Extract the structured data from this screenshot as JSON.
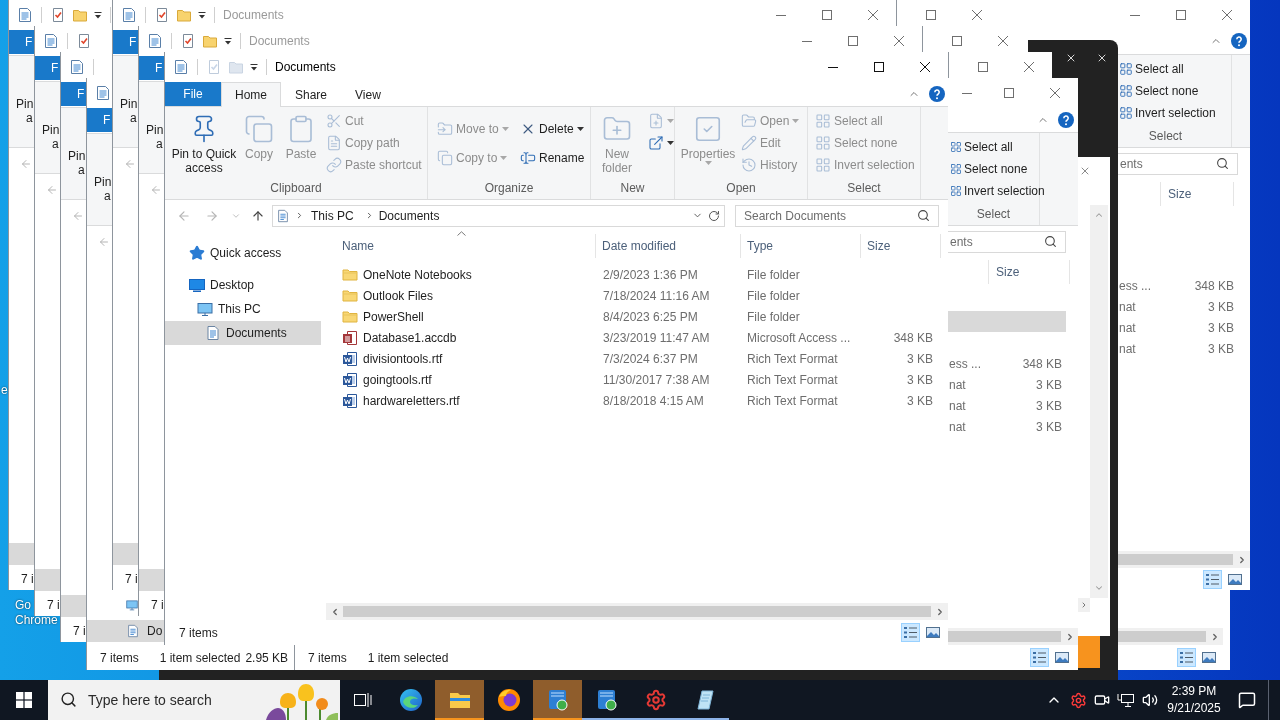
{
  "desktop": {
    "icon_labels": [
      {
        "lines": [
          "e"
        ]
      },
      {
        "lines": [
          "Go",
          "Chrome"
        ]
      }
    ]
  },
  "cascade_windows": [
    {
      "file_tab": "F",
      "pin_lines": [
        "Pin",
        "a"
      ],
      "nav_selected": true,
      "status": "7 i"
    },
    {
      "file_tab": "F",
      "pin_lines": [
        "Pin",
        "a"
      ],
      "nav_selected": true,
      "status": "7 i"
    },
    {
      "file_tab": "F",
      "pin_lines": [
        "Pin",
        "a"
      ],
      "nav_selected": true,
      "status": "7 i"
    },
    {
      "title": "Documents",
      "quick_access_disabled": false,
      "file_tab": "F",
      "pin_lines": [
        "Pin",
        "a"
      ],
      "nav_selected": true,
      "status": "7 i"
    },
    {
      "title": "Documents",
      "quick_access_disabled": false,
      "file_tab": "F",
      "pin_lines": [
        "Pin",
        "a"
      ],
      "nav_selected": true,
      "status": "7 i"
    }
  ],
  "lower_window": {
    "file_tab": "F",
    "pin_lines": [
      "Pin",
      "a"
    ],
    "nav_items": [
      {
        "selected": false
      },
      {
        "label": "Do",
        "selected": true
      }
    ],
    "status_bar": {
      "items": "7 items",
      "selection": "1 item selected",
      "size": "2.95 KB"
    }
  },
  "back_window": {
    "select_group": {
      "label": "Select",
      "items": [
        {
          "label": "Select all",
          "disabled": false
        },
        {
          "label": "Select none",
          "disabled": false
        },
        {
          "label": "Invert selection",
          "disabled": false
        }
      ]
    },
    "search": {
      "placeholder": "ents"
    },
    "columns": [
      {
        "label": "Size"
      }
    ],
    "rows": [
      {
        "selected": false
      },
      {
        "selected": false
      },
      {
        "selected": false
      },
      {
        "type": "ess ...",
        "size": "348 KB",
        "selected": false
      },
      {
        "type": "nat",
        "size": "3 KB",
        "selected": false
      },
      {
        "type": "nat",
        "size": "3 KB",
        "selected": false
      },
      {
        "type": "nat",
        "size": "3 KB",
        "selected": false
      }
    ],
    "view_buttons": [
      {
        "selected": true
      },
      {
        "selected": false
      }
    ]
  },
  "middle_window": {
    "select_group": {
      "label": "Select",
      "items": [
        {
          "label": "Select all",
          "disabled": false
        },
        {
          "label": "Select none",
          "disabled": false
        },
        {
          "label": "Invert selection",
          "disabled": false
        }
      ]
    },
    "search": {
      "placeholder": "ents"
    },
    "columns": [
      {
        "label": "Size"
      }
    ],
    "rows": [
      {
        "selected": false
      },
      {
        "selected": true
      },
      {
        "selected": false
      },
      {
        "type": "ess ...",
        "size": "348 KB",
        "selected": false
      },
      {
        "type": "nat",
        "size": "3 KB",
        "selected": false
      },
      {
        "type": "nat",
        "size": "3 KB",
        "selected": false
      },
      {
        "type": "nat",
        "size": "3 KB",
        "selected": false
      }
    ],
    "status_bar": {
      "items": "7 items",
      "selection": "1 item selected"
    },
    "view_buttons": [
      {
        "selected": true
      },
      {
        "selected": false
      }
    ]
  },
  "lower_right_window": {
    "view_buttons": [
      {
        "selected": true
      },
      {
        "selected": false
      }
    ]
  },
  "main_window": {
    "title": "Documents",
    "quick_access_disabled": true,
    "ribbon_tabs": [
      {
        "label": "File",
        "kind": "file",
        "selected": false
      },
      {
        "label": "Home",
        "kind": "tab",
        "selected": true
      },
      {
        "label": "Share",
        "kind": "tab",
        "selected": false
      },
      {
        "label": "View",
        "kind": "tab",
        "selected": false
      }
    ],
    "ribbon_groups": [
      {
        "label": "Clipboard",
        "columns": [
          {
            "kind": "large",
            "items": [
              {
                "label": "Pin to Quick access",
                "disabled": false,
                "dropdown": false
              }
            ]
          },
          {
            "kind": "large",
            "items": [
              {
                "label": "Copy",
                "disabled": true,
                "dropdown": false
              }
            ]
          },
          {
            "kind": "large",
            "items": [
              {
                "label": "Paste",
                "disabled": true,
                "dropdown": false
              }
            ]
          },
          {
            "kind": "stack",
            "items": [
              {
                "label": "Cut",
                "disabled": true,
                "dropdown": false
              },
              {
                "label": "Copy path",
                "disabled": true,
                "dropdown": false
              },
              {
                "label": "Paste shortcut",
                "disabled": true,
                "dropdown": false
              }
            ]
          }
        ]
      },
      {
        "label": "Organize",
        "columns": [
          {
            "kind": "pair",
            "items": [
              {
                "label": "Move to",
                "disabled": true,
                "dropdown": true
              },
              {
                "label": "Copy to",
                "disabled": true,
                "dropdown": true
              }
            ]
          },
          {
            "kind": "pair",
            "items": [
              {
                "label": "Delete",
                "disabled": false,
                "dropdown": true
              },
              {
                "label": "Rename",
                "disabled": false,
                "dropdown": false
              }
            ]
          }
        ]
      },
      {
        "label": "New",
        "columns": [
          {
            "kind": "large",
            "items": [
              {
                "label": "New folder",
                "disabled": true,
                "dropdown": false
              }
            ]
          },
          {
            "kind": "stack",
            "items": [
              {
                "disabled": true,
                "dropdown": true
              },
              {
                "disabled": false,
                "dropdown": true
              }
            ]
          }
        ]
      },
      {
        "label": "Open",
        "columns": [
          {
            "kind": "large",
            "items": [
              {
                "label": "Properties",
                "disabled": true,
                "dropdown": true
              }
            ]
          },
          {
            "kind": "stack",
            "items": [
              {
                "label": "Open",
                "disabled": true,
                "dropdown": true
              },
              {
                "label": "Edit",
                "disabled": true,
                "dropdown": false
              },
              {
                "label": "History",
                "disabled": true,
                "dropdown": false
              }
            ]
          }
        ]
      },
      {
        "label": "Select",
        "columns": [
          {
            "kind": "stack",
            "items": [
              {
                "label": "Select all",
                "disabled": true,
                "dropdown": false
              },
              {
                "label": "Select none",
                "disabled": true,
                "dropdown": false
              },
              {
                "label": "Invert selection",
                "disabled": true,
                "dropdown": false
              }
            ]
          }
        ]
      }
    ],
    "address": {
      "nav_buttons": [
        {
          "disabled": true
        },
        {
          "disabled": true
        },
        {
          "disabled": true
        },
        {
          "disabled": false
        }
      ],
      "path": [
        "This PC",
        "Documents"
      ],
      "search_placeholder": "Search Documents"
    },
    "nav_pane": [
      {
        "label": "Quick access",
        "selected": false
      },
      {
        "label": "Desktop",
        "selected": false,
        "children": [
          {
            "label": "This PC",
            "selected": false,
            "children": [
              {
                "label": "Documents",
                "selected": true
              }
            ]
          }
        ]
      }
    ],
    "columns": [
      {
        "label": "Name",
        "sorted": true
      },
      {
        "label": "Date modified",
        "sorted": false
      },
      {
        "label": "Type",
        "sorted": false
      },
      {
        "label": "Size",
        "sorted": false
      }
    ],
    "rows": [
      {
        "kind": "folder",
        "name": "OneNote Notebooks",
        "date": "2/9/2023 1:36 PM",
        "type": "File folder",
        "selected": false
      },
      {
        "kind": "folder",
        "name": "Outlook Files",
        "date": "7/18/2024 11:16 AM",
        "type": "File folder",
        "selected": false
      },
      {
        "kind": "folder",
        "name": "PowerShell",
        "date": "8/4/2023 6:25 PM",
        "type": "File folder",
        "selected": false
      },
      {
        "kind": "access",
        "name": "Database1.accdb",
        "date": "3/23/2019 11:47 AM",
        "type": "Microsoft Access ...",
        "size": "348 KB",
        "selected": false
      },
      {
        "kind": "word",
        "name": "divisiontools.rtf",
        "date": "7/3/2024 6:37 PM",
        "type": "Rich Text Format",
        "size": "3 KB",
        "selected": false
      },
      {
        "kind": "word",
        "name": "goingtools.rtf",
        "date": "11/30/2017 7:38 AM",
        "type": "Rich Text Format",
        "size": "3 KB",
        "selected": false
      },
      {
        "kind": "word",
        "name": "hardwareletters.rtf",
        "date": "8/18/2018 4:15 AM",
        "type": "Rich Text Format",
        "size": "3 KB",
        "selected": false
      }
    ],
    "status_bar": {
      "items": "7 items"
    },
    "view_buttons": [
      {
        "selected": true
      },
      {
        "selected": false
      }
    ]
  },
  "taskbar": {
    "search": {
      "placeholder": "Type here to search"
    },
    "apps": [
      {
        "active": false,
        "running": false
      },
      {
        "active": true,
        "running": true
      },
      {
        "active": false,
        "running": false
      },
      {
        "active": true,
        "running": true
      },
      {
        "active": false,
        "running": true
      },
      {
        "active": false,
        "running": true
      },
      {
        "active": false,
        "running": true
      }
    ],
    "clock": {
      "time": "2:39 PM",
      "date": "9/21/2025"
    }
  }
}
